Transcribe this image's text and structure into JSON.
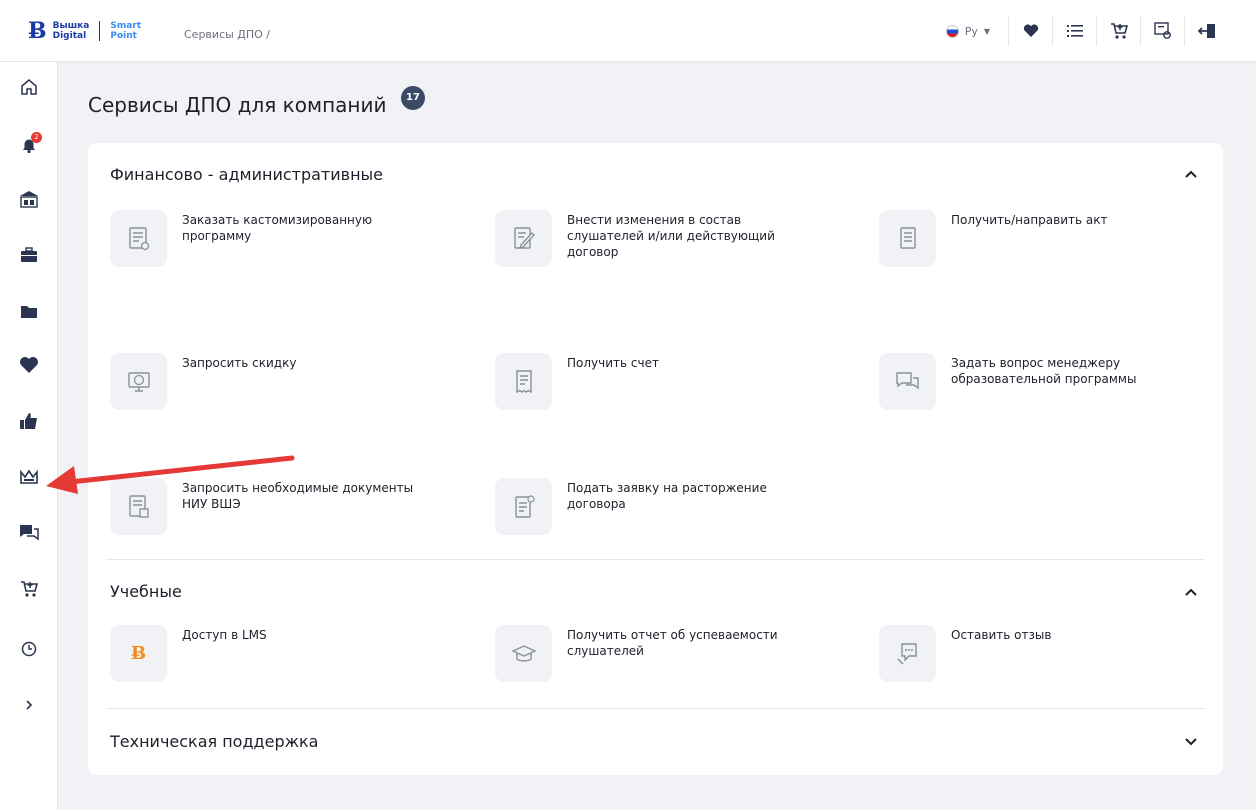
{
  "header": {
    "logo_brand_line1": "Вышка",
    "logo_brand_line2": "Digital",
    "logo_product_line1": "Smart",
    "logo_product_line2": "Point",
    "breadcrumb": "Сервисы ДПО  /",
    "language": "Ру",
    "icons": [
      "heart-icon",
      "list-icon",
      "cart-icon",
      "certificate-icon",
      "logout-icon"
    ]
  },
  "sidebar": {
    "notifications_count": "2",
    "items": [
      "home-icon",
      "bell-icon",
      "university-icon",
      "briefcase-icon",
      "folder-icon",
      "heart-icon",
      "thumbs-up-icon",
      "crown-icon",
      "chat-icon",
      "cart-icon",
      "clock-icon",
      "expand-icon"
    ]
  },
  "page": {
    "title": "Сервисы ДПО для компаний",
    "count": "17"
  },
  "sections": [
    {
      "title": "Финансово - административные",
      "expanded": true,
      "items": [
        "Заказать кастомизированную программу",
        "Внести изменения в состав слушателей и/или действующий договор",
        "Получить/направить акт",
        "Запросить скидку",
        "Получить счет",
        "Задать вопрос менеджеру образовательной программы",
        "Запросить необходимые документы НИУ ВШЭ",
        "Подать заявку на расторжение договора"
      ]
    },
    {
      "title": "Учебные",
      "expanded": true,
      "items": [
        "Доступ в LMS",
        "Получить отчет об успеваемости слушателей",
        "Оставить отзыв"
      ]
    },
    {
      "title": "Техническая поддержка",
      "expanded": false,
      "items": []
    }
  ],
  "colors": {
    "brand": "#1a3aa8",
    "accent_light": "#3a8ef0",
    "badge_red": "#e53935",
    "arrow_red": "#e53935",
    "lms_orange": "#f28c1c"
  }
}
